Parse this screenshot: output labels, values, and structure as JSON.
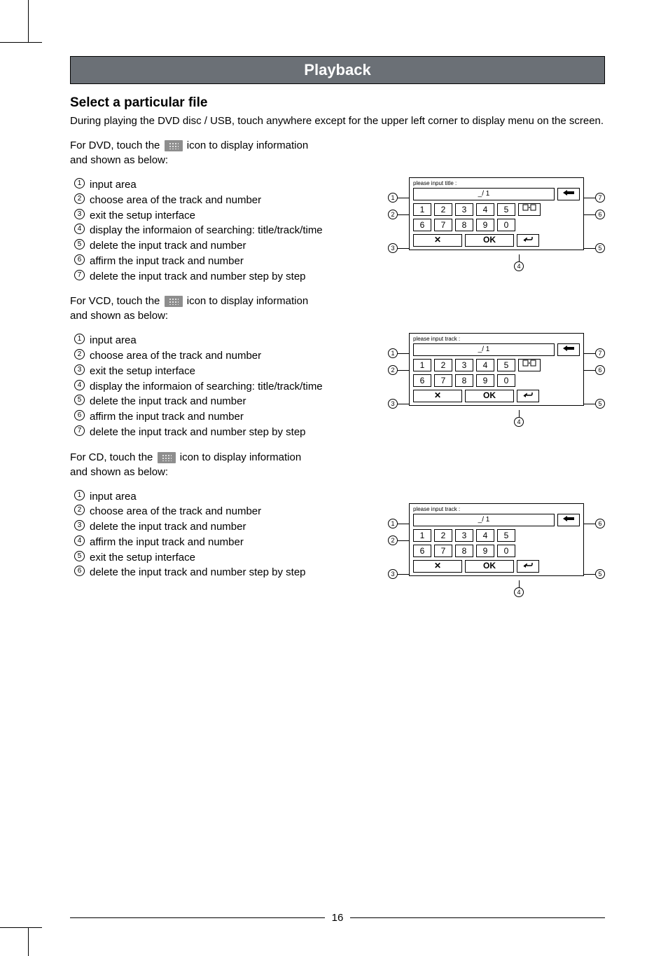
{
  "page_title": "Playback",
  "section_title": "Select a particular file",
  "intro": "During playing the DVD disc / USB, touch anywhere except for the upper left corner to display menu on the screen.",
  "dvd": {
    "lead_pre": "For DVD, touch the",
    "lead_post": "icon to display information",
    "lead_tail": "and shown as below:",
    "items": [
      "input area",
      "choose area of the track and number",
      "exit the setup interface",
      "display the informaion of searching: title/track/time",
      "delete the input track and number",
      "affirm the input track and number",
      "delete the input track and number step by step"
    ],
    "panel_title": "please  input  title :",
    "input_value": "_/ 1",
    "keys_r1": [
      "1",
      "2",
      "3",
      "4",
      "5"
    ],
    "keys_r2": [
      "6",
      "7",
      "8",
      "9",
      "0"
    ],
    "ok": "OK"
  },
  "vcd": {
    "lead_pre": "For VCD, touch the",
    "lead_post": "icon to display information",
    "lead_tail": "and shown as below:",
    "items": [
      "input area",
      "choose area of the track and number",
      "exit the setup interface",
      "display the informaion of searching: title/track/time",
      "delete the input track and number",
      "affirm the input track and number",
      "delete the input track and number step by step"
    ],
    "panel_title": "please  input  track :",
    "input_value": "_/ 1",
    "keys_r1": [
      "1",
      "2",
      "3",
      "4",
      "5"
    ],
    "keys_r2": [
      "6",
      "7",
      "8",
      "9",
      "0"
    ],
    "ok": "OK"
  },
  "cd": {
    "lead_pre": "For CD, touch the",
    "lead_post": "icon to display information",
    "lead_tail": "and shown as below:",
    "items": [
      "input area",
      "choose area of the track and number",
      "delete the input track and number",
      "affirm the input track and number",
      "exit the setup interface",
      "delete the input track and number step by step"
    ],
    "panel_title": "please  input  track :",
    "input_value": "_/ 1",
    "keys_r1": [
      "1",
      "2",
      "3",
      "4",
      "5"
    ],
    "keys_r2": [
      "6",
      "7",
      "8",
      "9",
      "0"
    ],
    "ok": "OK"
  },
  "page_number": "16",
  "callout_marks": [
    "1",
    "2",
    "3",
    "4",
    "5",
    "6",
    "7"
  ]
}
